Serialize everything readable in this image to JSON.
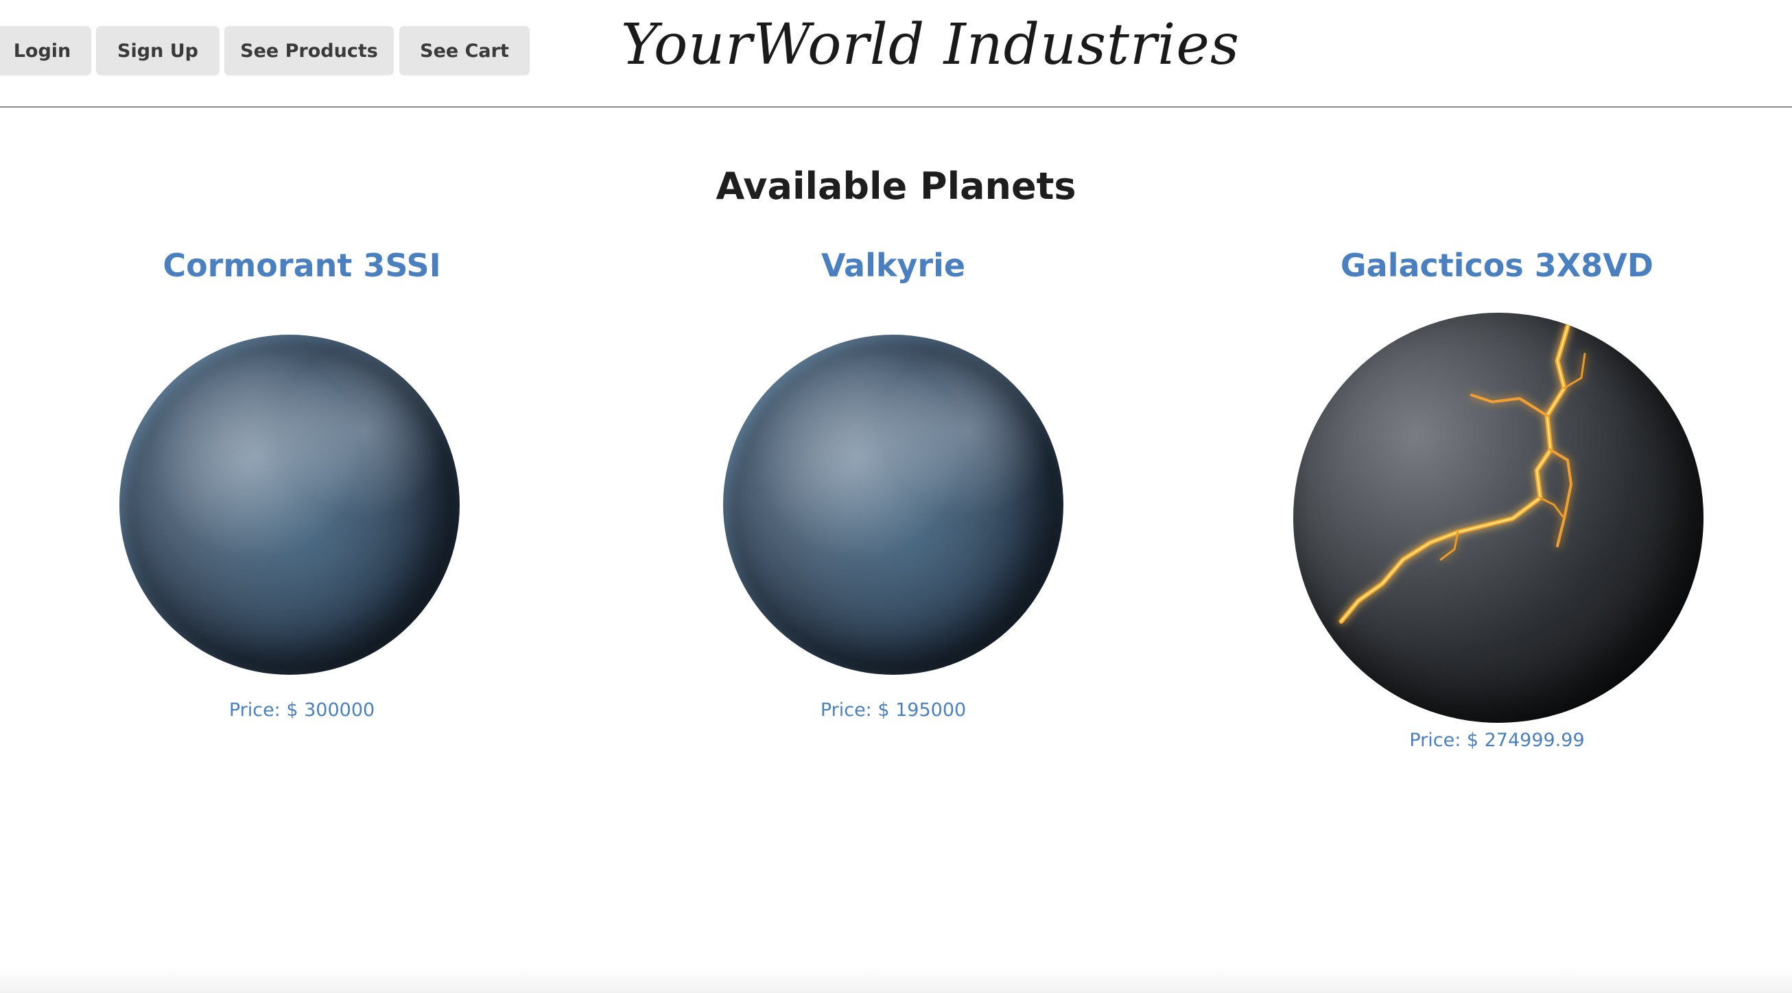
{
  "nav": {
    "login": "Login",
    "signup": "Sign Up",
    "products": "See Products",
    "cart": "See Cart"
  },
  "site": {
    "title": "YourWorld Industries"
  },
  "main": {
    "heading": "Available Planets",
    "products": [
      {
        "name": "Cormorant 3SSI",
        "price": "Price: $ 300000",
        "image": "blue-planet-image"
      },
      {
        "name": "Valkyrie",
        "price": "Price: $ 195000",
        "image": "blue-planet-image"
      },
      {
        "name": "Galacticos 3X8VD",
        "price": "Price: $ 274999.99",
        "image": "lava-planet-image"
      }
    ]
  },
  "colors": {
    "link": "#4a80c0",
    "button_bg": "#e6e6e6",
    "divider": "#8a8a8a"
  }
}
